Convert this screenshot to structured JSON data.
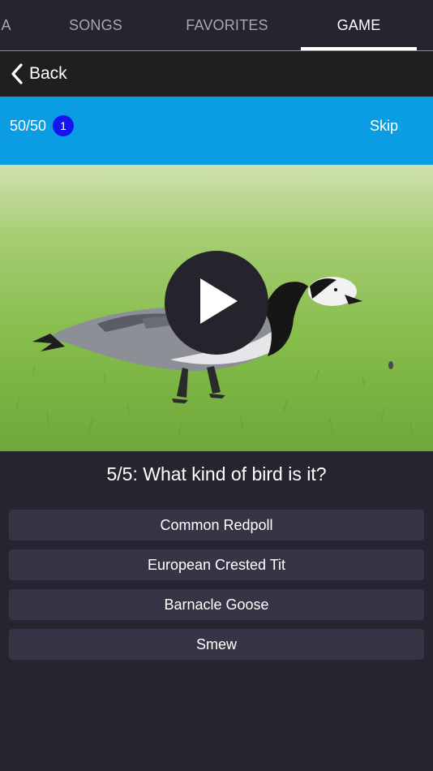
{
  "tabs": [
    {
      "label": "MA",
      "active": false
    },
    {
      "label": "SONGS",
      "active": false
    },
    {
      "label": "FAVORITES",
      "active": false
    },
    {
      "label": "GAME",
      "active": true
    }
  ],
  "nav": {
    "back_label": "Back"
  },
  "status": {
    "score": "50/50",
    "badge_count": "1",
    "skip_label": "Skip"
  },
  "media": {
    "image_subject": "bird",
    "play_icon": "play-icon"
  },
  "question": {
    "text": "5/5: What kind of bird is it?"
  },
  "answers": [
    {
      "label": "Common Redpoll"
    },
    {
      "label": "European Crested Tit"
    },
    {
      "label": "Barnacle Goose"
    },
    {
      "label": "Smew"
    }
  ],
  "colors": {
    "background": "#25242f",
    "navbar": "#1f1f1f",
    "status_bar": "#0a9de3",
    "badge": "#1414ee",
    "answer_button": "#373545",
    "grass": "#7db83f"
  }
}
